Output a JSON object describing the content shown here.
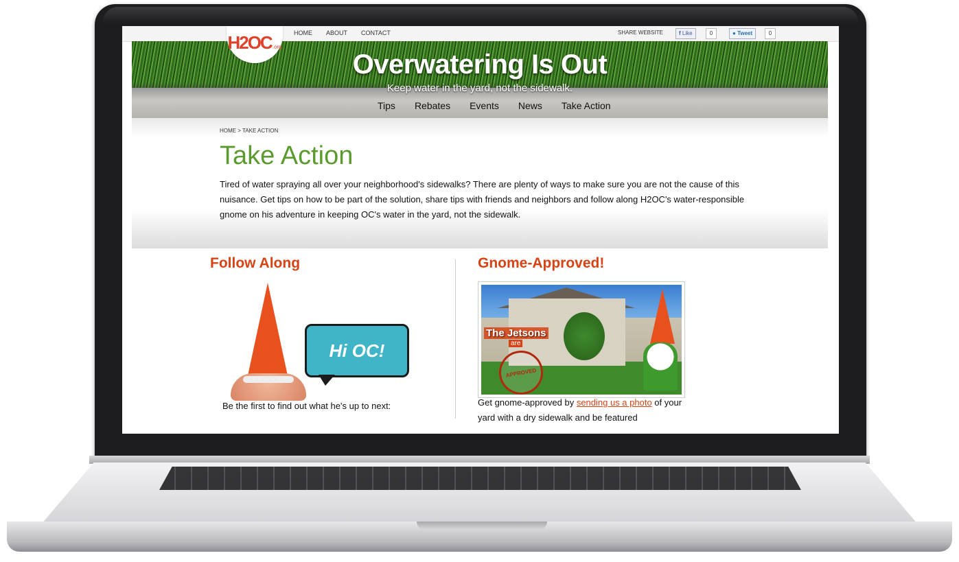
{
  "topbar": {
    "logo_mark": "H2OC",
    "logo_suffix": ".org",
    "nav": [
      "HOME",
      "ABOUT",
      "CONTACT"
    ],
    "share_label": "SHARE WEBSITE",
    "like_label": "Like",
    "like_count": "0",
    "tweet_label": "Tweet",
    "tweet_count": "0"
  },
  "hero": {
    "title": "Overwatering Is Out",
    "subtitle": "Keep water in the yard, not the sidewalk.",
    "nav": [
      "Tips",
      "Rebates",
      "Events",
      "News",
      "Take Action"
    ]
  },
  "intro": {
    "breadcrumb": "HOME > TAKE ACTION",
    "title": "Take Action",
    "text": "Tired of water spraying all over your neighborhood's sidewalks? There are plenty of ways to make sure you are not the cause of this nuisance. Get tips on how to be part of the solution, share tips with friends and neighbors and follow along H2OC's water-responsible gnome on his adventure in keeping OC's water in the yard, not the sidewalk."
  },
  "follow": {
    "title": "Follow Along",
    "bubble": "Hi OC!",
    "caption": "Be the first to find out what he's up to next:"
  },
  "approved": {
    "title": "Gnome-Approved!",
    "photo_banner": "The Jetsons",
    "photo_banner_sub": "are",
    "stamp": "APPROVED",
    "caption_before": "Get gnome-approved by ",
    "caption_link": "sending us a photo",
    "caption_after": " of your yard with a dry sidewalk and be featured"
  },
  "colors": {
    "accent_green": "#5a9a2e",
    "accent_orange": "#d84315",
    "bubble_teal": "#3fb5c7"
  }
}
